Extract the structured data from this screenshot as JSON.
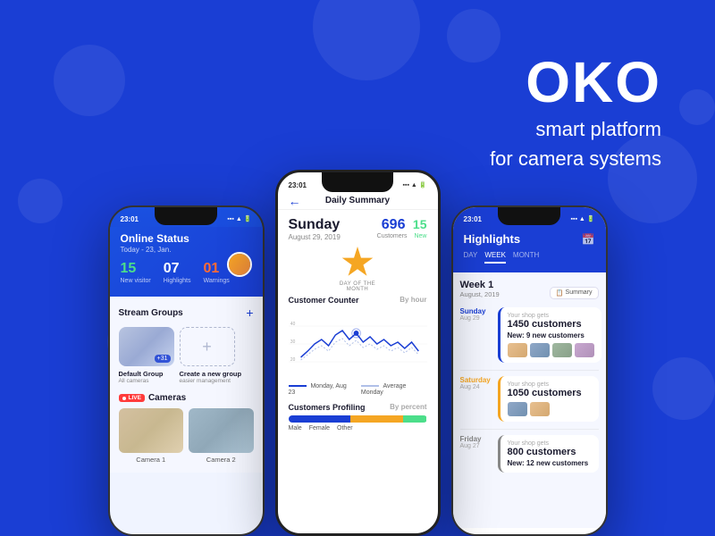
{
  "brand": {
    "name": "OKO",
    "subtitle_line1": "smart platform",
    "subtitle_line2": "for camera systems"
  },
  "left_phone": {
    "status_bar_time": "23:01",
    "header": {
      "title": "Online Status",
      "date": "Today - 23, Jan."
    },
    "stats": [
      {
        "num": "15",
        "label": "New visitor",
        "color": "green"
      },
      {
        "num": "07",
        "label": "Highlights",
        "color": "white"
      },
      {
        "num": "01",
        "label": "Warnings",
        "color": "orange"
      }
    ],
    "stream_groups": {
      "title": "Stream Groups",
      "groups": [
        {
          "name": "Default Group",
          "sub": "All cameras",
          "count": "+31"
        },
        {
          "name": "Create a new group",
          "sub": "easier management"
        }
      ]
    },
    "cameras": {
      "title": "Cameras",
      "items": [
        {
          "label": "Camera 1"
        },
        {
          "label": "Camera 2"
        }
      ]
    }
  },
  "middle_phone": {
    "status_bar_time": "23:01",
    "header_title": "Daily Summary",
    "day": "Sunday",
    "date": "August 29, 2019",
    "customers": "696",
    "customers_new": "15",
    "customers_label": "Customers",
    "new_label": "New",
    "badge_label": "DAY OF THE MONTH",
    "counter": {
      "title": "Customer Counter",
      "by_label": "By hour",
      "legend": [
        {
          "label": "Monday, Aug 23",
          "color": "#1a3ed4"
        },
        {
          "label": "Average Monday",
          "color": "#aab8e0"
        }
      ]
    },
    "profiling": {
      "title": "Customers Profiling",
      "by_label": "By percent",
      "bars": [
        {
          "label": "Male",
          "pct": 45,
          "color": "#1a3ed4"
        },
        {
          "label": "Female",
          "pct": 38,
          "color": "#f5a623"
        },
        {
          "label": "Other",
          "pct": 17,
          "color": "#4cde8a"
        }
      ]
    }
  },
  "right_phone": {
    "status_bar_time": "23:01",
    "header": {
      "title": "Highlights",
      "tabs": [
        "DAY",
        "WEEK",
        "MONTH"
      ],
      "active_tab": "WEEK"
    },
    "week": {
      "title": "Week 1",
      "date": "August, 2019",
      "summary_btn": "Summary"
    },
    "items": [
      {
        "day": "Sunday",
        "day_short": "Sunday",
        "date": "Aug 29",
        "shop_label": "Your shop gets",
        "customers": "1450 customers",
        "new_label": "New:",
        "new_count": "9 new customers",
        "has_thumbs": true
      },
      {
        "day": "Saturday",
        "day_short": "Saturday",
        "date": "Aug 24",
        "shop_label": "Your shop gets",
        "customers": "1050 customers",
        "new_label": "",
        "new_count": "",
        "has_thumbs": true
      },
      {
        "day": "Friday",
        "day_short": "Friday",
        "date": "Aug 27",
        "shop_label": "Your shop gets",
        "customers": "800 customers",
        "new_label": "New:",
        "new_count": "12 new customers",
        "has_thumbs": false
      }
    ]
  },
  "colors": {
    "primary": "#1a3ed4",
    "accent": "#4cde8a",
    "warning": "#f5a623",
    "danger": "#ff3b3b",
    "bg": "#1a3ed4"
  }
}
